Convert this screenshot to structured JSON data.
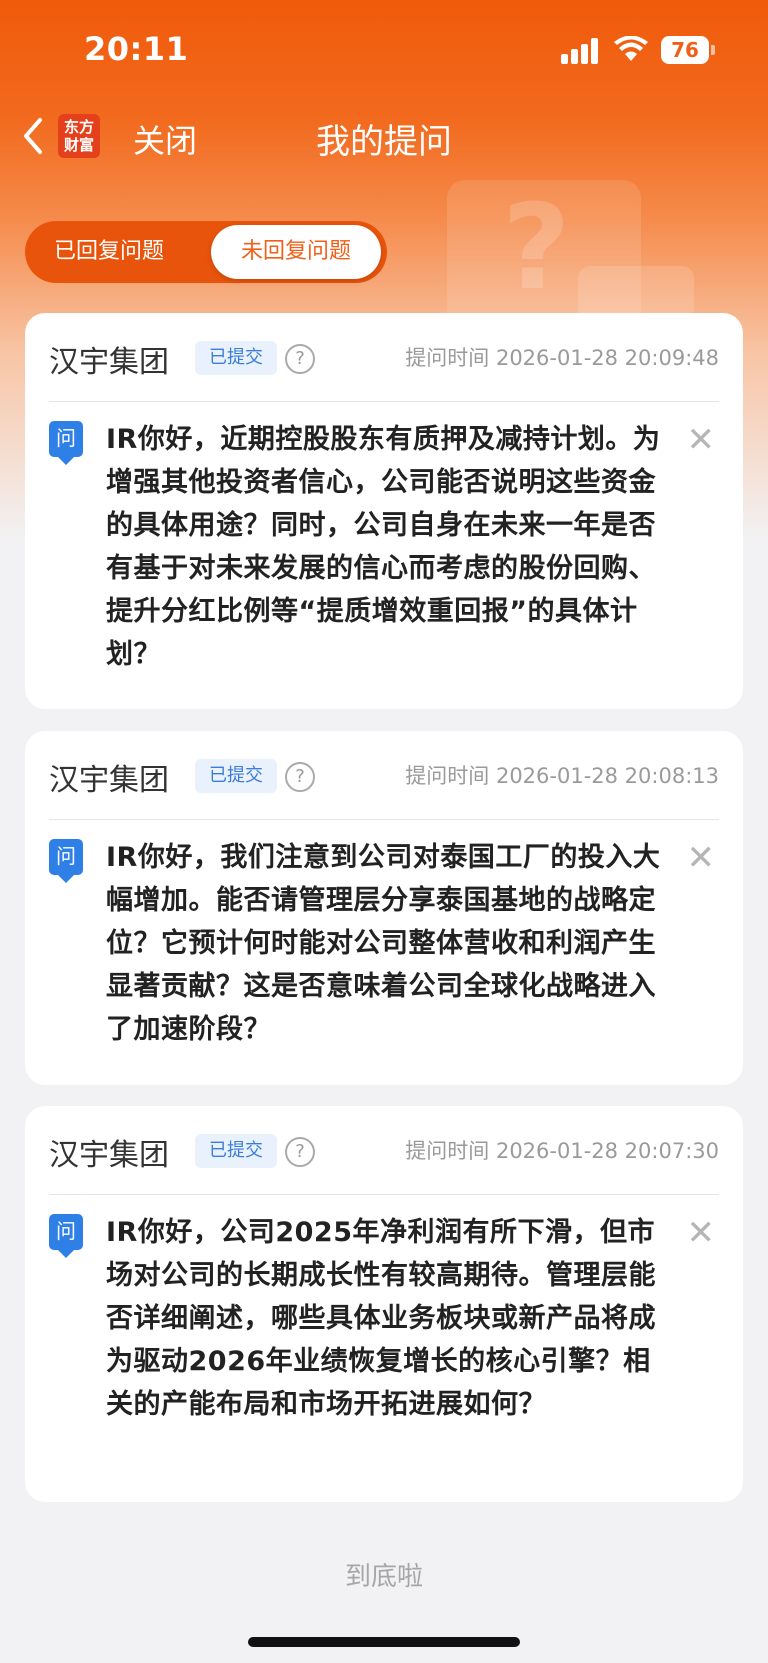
{
  "status_bar": {
    "time": "20:11",
    "battery": "76"
  },
  "nav": {
    "logo_text_line1": "东方",
    "logo_text_line2": "财富",
    "close_label": "关闭",
    "title": "我的提问"
  },
  "tabs": [
    {
      "label": "已回复问题",
      "selected": false
    },
    {
      "label": "未回复问题",
      "selected": true
    }
  ],
  "questions": [
    {
      "company": "汉宇集团",
      "status": "已提交",
      "time_label": "提问时间 2026-01-28 20:09:48",
      "icon_text": "问",
      "text": "IR你好，近期控股股东有质押及减持计划。为增强其他投资者信心，公司能否说明这些资金的具体用途？同时，公司自身在未来一年是否有基于对未来发展的信心而考虑的股份回购、提升分红比例等“提质增效重回报”的具体计划？"
    },
    {
      "company": "汉宇集团",
      "status": "已提交",
      "time_label": "提问时间 2026-01-28 20:08:13",
      "icon_text": "问",
      "text": "IR你好，我们注意到公司对泰国工厂的投入大幅增加。能否请管理层分享泰国基地的战略定位？它预计何时能对公司整体营收和利润产生显著贡献？这是否意味着公司全球化战略进入了加速阶段？"
    },
    {
      "company": "汉宇集团",
      "status": "已提交",
      "time_label": "提问时间 2026-01-28 20:07:30",
      "icon_text": "问",
      "text": "IR你好，公司2025年净利润有所下滑，但市场对公司的长期成长性有较高期待。管理层能否详细阐述，哪些具体业务板块或新产品将成为驱动2026年业绩恢复增长的核心引擎？相关的产能布局和市场开拓进展如何？"
    }
  ],
  "footer": "到底啦",
  "colors": {
    "brand": "#f05a0a",
    "badge_text": "#3b7dd8",
    "icon_blue": "#2e7fe6"
  }
}
